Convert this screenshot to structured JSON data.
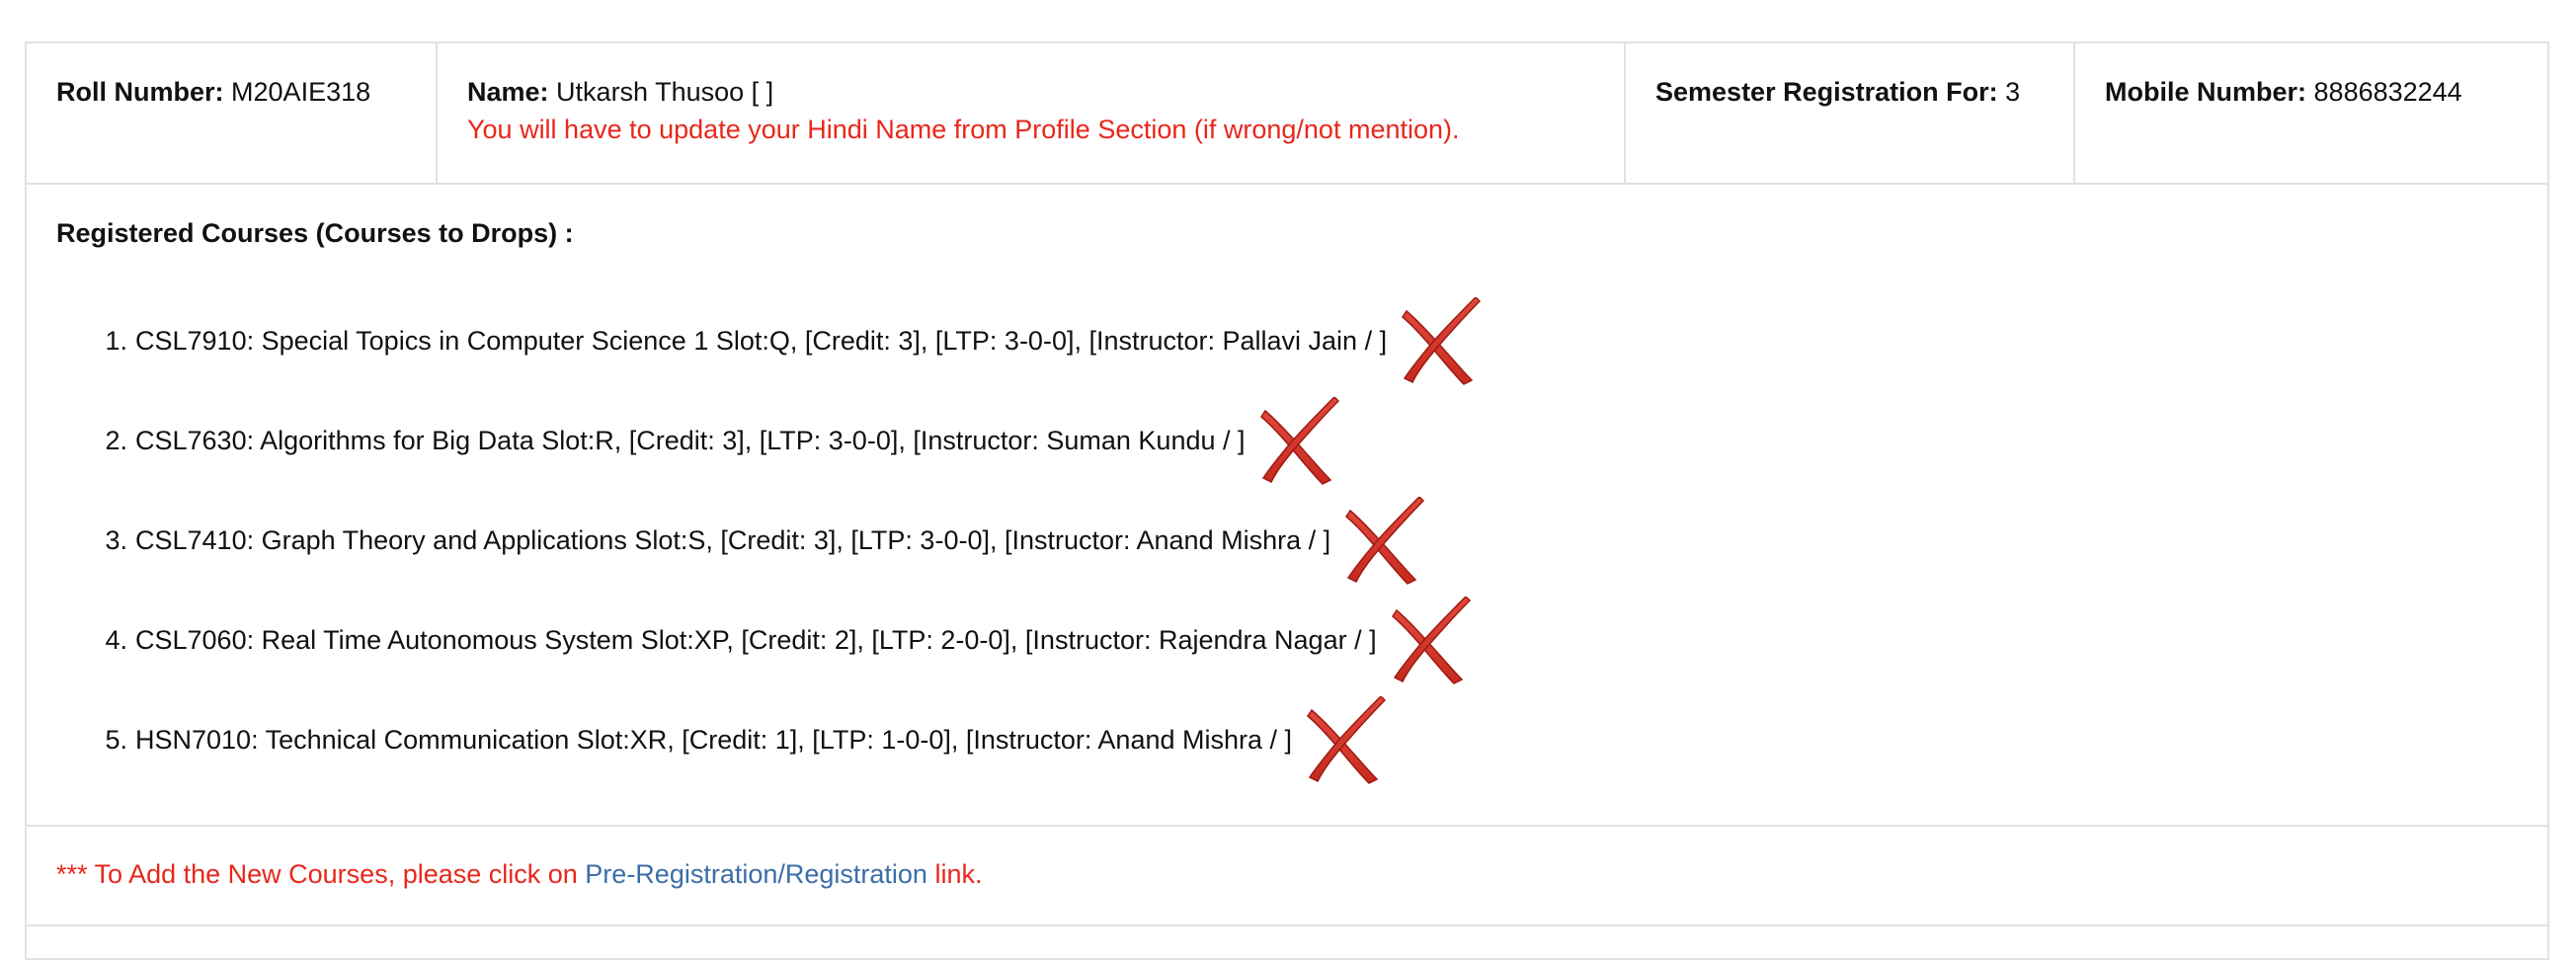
{
  "student": {
    "roll_label": "Roll Number:",
    "roll_value": "M20AIE318",
    "name_label": "Name:",
    "name_value": "Utkarsh Thusoo [ ]",
    "name_warning": "You will have to update your Hindi Name from Profile Section (if wrong/not mention).",
    "semester_label": "Semester Registration For:",
    "semester_value": "3",
    "mobile_label": "Mobile Number:",
    "mobile_value": "8886832244"
  },
  "courses": {
    "heading": "Registered Courses (Courses to Drops) :",
    "items": [
      {
        "num": "1.",
        "text": "CSL7910: Special Topics in Computer Science 1 Slot:Q, [Credit: 3], [LTP: 3-0-0], [Instructor: Pallavi Jain / ]",
        "icon": "drop-x-icon"
      },
      {
        "num": "2.",
        "text": "CSL7630: Algorithms for Big Data Slot:R, [Credit: 3], [LTP: 3-0-0], [Instructor: Suman Kundu / ]",
        "icon": "drop-x-icon"
      },
      {
        "num": "3.",
        "text": "CSL7410: Graph Theory and Applications Slot:S, [Credit: 3], [LTP: 3-0-0], [Instructor: Anand Mishra / ]",
        "icon": "drop-x-icon"
      },
      {
        "num": "4.",
        "text": "CSL7060: Real Time Autonomous System Slot:XP, [Credit: 2], [LTP: 2-0-0], [Instructor: Rajendra Nagar / ]",
        "icon": "drop-x-icon"
      },
      {
        "num": "5.",
        "text": "HSN7010: Technical Communication Slot:XR, [Credit: 1], [LTP: 1-0-0], [Instructor: Anand Mishra / ]",
        "icon": "drop-x-icon"
      }
    ]
  },
  "footer": {
    "prefix": "*** To Add the New Courses, please click on ",
    "link_text": "Pre-Registration/Registration",
    "suffix": " link."
  },
  "colors": {
    "warning": "#e8271b",
    "link": "#3b6ea8",
    "border": "#e1e1e1",
    "drop_icon": "#c62a1f"
  }
}
